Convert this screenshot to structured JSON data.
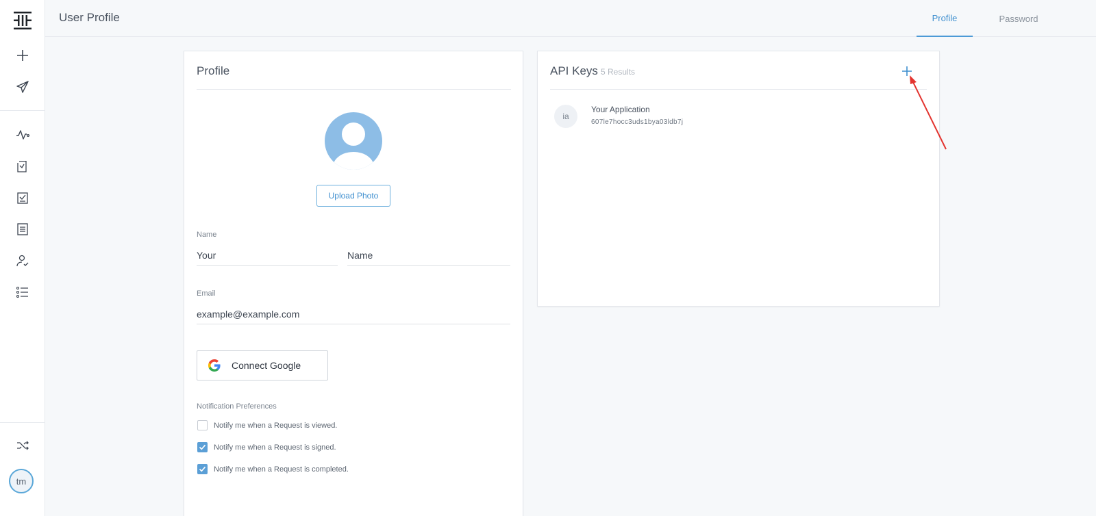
{
  "header": {
    "title": "User Profile",
    "tabs": [
      {
        "label": "Profile",
        "active": true
      },
      {
        "label": "Password",
        "active": false
      }
    ]
  },
  "sidebar": {
    "items": [
      {
        "icon": "logo-icon"
      },
      {
        "icon": "plus-icon"
      },
      {
        "icon": "paper-plane-icon"
      },
      {
        "icon": "activity-icon"
      },
      {
        "icon": "document-upload-icon"
      },
      {
        "icon": "document-check-icon"
      },
      {
        "icon": "document-lines-icon"
      },
      {
        "icon": "user-check-icon"
      },
      {
        "icon": "list-icon"
      },
      {
        "icon": "shuffle-icon"
      }
    ],
    "avatar_initials": "tm"
  },
  "profile": {
    "title": "Profile",
    "upload_label": "Upload Photo",
    "name_label": "Name",
    "first_name": "Your",
    "last_name": "Name",
    "email_label": "Email",
    "email": "example@example.com",
    "google_label": "Connect Google",
    "prefs_label": "Notification Preferences",
    "prefs": [
      {
        "label": "Notify me when a Request is viewed.",
        "checked": false
      },
      {
        "label": "Notify me when a Request is signed.",
        "checked": true
      },
      {
        "label": "Notify me when a Request is completed.",
        "checked": true
      }
    ]
  },
  "api_keys": {
    "title": "API Keys",
    "count": "5 Results",
    "items": [
      {
        "initials": "ia",
        "name": "Your Application",
        "key": "607le7hocc3uds1bya03ldb7j"
      }
    ]
  },
  "colors": {
    "accent": "#3f8fcf",
    "annotation": "#e3342f",
    "checkbox": "#5b9fd6"
  }
}
